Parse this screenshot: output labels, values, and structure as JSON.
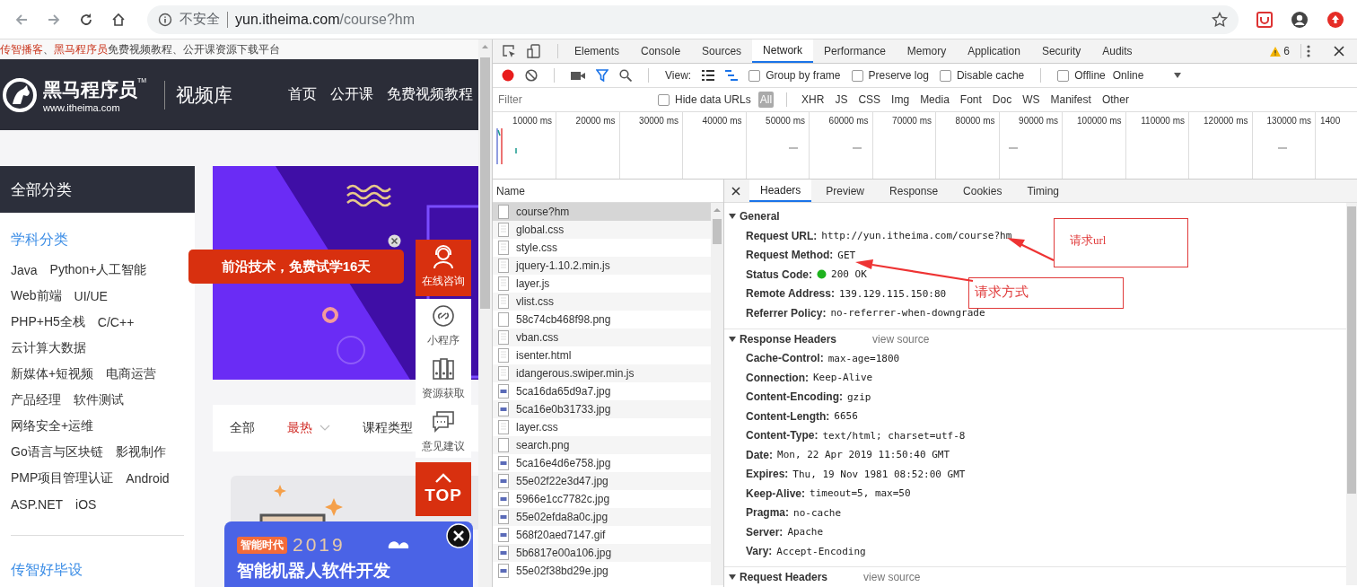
{
  "browser": {
    "security_label": "不安全",
    "url_host": "yun.itheima.com",
    "url_path": "/course?hm"
  },
  "page": {
    "notice": [
      {
        "text": "传智播客",
        "highlight": true
      },
      {
        "text": "、",
        "highlight": false
      },
      {
        "text": "黑马程序员",
        "highlight": true
      },
      {
        "text": "免费视频教程、公开课资源下载平台",
        "highlight": false
      }
    ],
    "logo": {
      "brand": "黑马程序员",
      "trademark": "TM",
      "site": "www.itheima.com",
      "section": "视频库"
    },
    "nav": [
      "首页",
      "公开课",
      "免费视频教程"
    ],
    "sidebar": {
      "title": "全部分类",
      "section": "学科分类",
      "rows": [
        [
          "Java",
          "Python+人工智能"
        ],
        [
          "Web前端",
          "UI/UE"
        ],
        [
          "PHP+H5全栈",
          "C/C++"
        ],
        [
          "云计算大数据"
        ],
        [
          "新媒体+短视频",
          "电商运营"
        ],
        [
          "产品经理",
          "软件测试"
        ],
        [
          "网络安全+运维"
        ],
        [
          "Go语言与区块链",
          "影视制作"
        ],
        [
          "PMP项目管理认证",
          "Android"
        ],
        [
          "ASP.NET",
          "iOS"
        ]
      ],
      "footer": "传智好毕设"
    },
    "promo": "前沿技术，免费试学16天",
    "side_tools": [
      {
        "kind": "accent",
        "label": "在线咨询"
      },
      {
        "kind": "plain",
        "label": "小程序"
      },
      {
        "kind": "plain",
        "label": "资源获取"
      },
      {
        "kind": "plain",
        "label": "意见建议"
      }
    ],
    "top_button": "TOP",
    "filters": [
      {
        "label": "全部",
        "selected": false,
        "dropdown": false
      },
      {
        "label": "最热",
        "selected": true,
        "dropdown": true
      },
      {
        "label": "课程类型",
        "selected": false,
        "dropdown": false
      }
    ],
    "ad": {
      "badge": "智能时代",
      "year": "2019",
      "title": "智能机器人软件开发"
    }
  },
  "devtools": {
    "tabs": [
      {
        "label": "Elements",
        "selected": false
      },
      {
        "label": "Console",
        "selected": false
      },
      {
        "label": "Sources",
        "selected": false
      },
      {
        "label": "Network",
        "selected": true
      },
      {
        "label": "Performance",
        "selected": false
      },
      {
        "label": "Memory",
        "selected": false
      },
      {
        "label": "Application",
        "selected": false
      },
      {
        "label": "Security",
        "selected": false
      },
      {
        "label": "Audits",
        "selected": false
      }
    ],
    "warnings": "6",
    "toolbar": {
      "recording": true,
      "view_label": "View:",
      "options": [
        {
          "label": "Group by frame",
          "checked": false
        },
        {
          "label": "Preserve log",
          "checked": false
        },
        {
          "label": "Disable cache",
          "checked": false
        },
        {
          "label": "Offline",
          "checked": false
        }
      ],
      "throttling": "Online"
    },
    "filter": {
      "placeholder": "Filter",
      "hide_data_urls": {
        "label": "Hide data URLs",
        "checked": false
      },
      "types": [
        {
          "label": "All",
          "selected": true
        },
        {
          "label": "XHR",
          "selected": false
        },
        {
          "label": "JS",
          "selected": false
        },
        {
          "label": "CSS",
          "selected": false
        },
        {
          "label": "Img",
          "selected": false
        },
        {
          "label": "Media",
          "selected": false
        },
        {
          "label": "Font",
          "selected": false
        },
        {
          "label": "Doc",
          "selected": false
        },
        {
          "label": "WS",
          "selected": false
        },
        {
          "label": "Manifest",
          "selected": false
        },
        {
          "label": "Other",
          "selected": false
        }
      ]
    },
    "timeline_ticks": [
      "10000 ms",
      "20000 ms",
      "30000 ms",
      "40000 ms",
      "50000 ms",
      "60000 ms",
      "70000 ms",
      "80000 ms",
      "90000 ms",
      "100000 ms",
      "110000 ms",
      "120000 ms",
      "130000 ms",
      "1400"
    ],
    "requests": {
      "column": "Name",
      "rows": [
        {
          "name": "course?hm",
          "kind": "blank",
          "selected": true
        },
        {
          "name": "global.css",
          "kind": "file",
          "selected": false
        },
        {
          "name": "style.css",
          "kind": "file",
          "selected": false
        },
        {
          "name": "jquery-1.10.2.min.js",
          "kind": "file",
          "selected": false
        },
        {
          "name": "layer.js",
          "kind": "file",
          "selected": false
        },
        {
          "name": "vlist.css",
          "kind": "file",
          "selected": false
        },
        {
          "name": "58c74cb468f98.png",
          "kind": "blank",
          "selected": false
        },
        {
          "name": "vban.css",
          "kind": "file",
          "selected": false
        },
        {
          "name": "isenter.html",
          "kind": "file",
          "selected": false
        },
        {
          "name": "idangerous.swiper.min.js",
          "kind": "file",
          "selected": false
        },
        {
          "name": "5ca16da65d9a7.jpg",
          "kind": "image",
          "selected": false
        },
        {
          "name": "5ca16e0b31733.jpg",
          "kind": "image",
          "selected": false
        },
        {
          "name": "layer.css",
          "kind": "file",
          "selected": false
        },
        {
          "name": "search.png",
          "kind": "blank",
          "selected": false
        },
        {
          "name": "5ca16e4d6e758.jpg",
          "kind": "image",
          "selected": false
        },
        {
          "name": "55e02f22e3d47.jpg",
          "kind": "image",
          "selected": false
        },
        {
          "name": "5966e1cc7782c.jpg",
          "kind": "image",
          "selected": false
        },
        {
          "name": "55e02efda8a0c.jpg",
          "kind": "image",
          "selected": false
        },
        {
          "name": "568f20aed7147.gif",
          "kind": "image",
          "selected": false
        },
        {
          "name": "5b6817e00a106.jpg",
          "kind": "image",
          "selected": false
        },
        {
          "name": "55e02f38bd29e.jpg",
          "kind": "image",
          "selected": false
        }
      ]
    },
    "details": {
      "tabs": [
        {
          "label": "Headers",
          "selected": true
        },
        {
          "label": "Preview",
          "selected": false
        },
        {
          "label": "Response",
          "selected": false
        },
        {
          "label": "Cookies",
          "selected": false
        },
        {
          "label": "Timing",
          "selected": false
        }
      ],
      "sections": [
        {
          "title": "General",
          "expanded": true,
          "rows": [
            {
              "key": "Request URL:",
              "value": "http://yun.itheima.com/course?hm",
              "kind": "plain"
            },
            {
              "key": "Request Method:",
              "value": "GET",
              "kind": "plain"
            },
            {
              "key": "Status Code:",
              "value": "200 OK",
              "kind": "status"
            },
            {
              "key": "Remote Address:",
              "value": "139.129.115.150:80",
              "kind": "plain"
            },
            {
              "key": "Referrer Policy:",
              "value": "no-referrer-when-downgrade",
              "kind": "plain"
            }
          ]
        },
        {
          "title": "Response Headers",
          "action": "view source",
          "expanded": true,
          "rows": [
            {
              "key": "Cache-Control:",
              "value": "max-age=1800",
              "kind": "plain"
            },
            {
              "key": "Connection:",
              "value": "Keep-Alive",
              "kind": "plain"
            },
            {
              "key": "Content-Encoding:",
              "value": "gzip",
              "kind": "plain"
            },
            {
              "key": "Content-Length:",
              "value": "6656",
              "kind": "plain"
            },
            {
              "key": "Content-Type:",
              "value": "text/html; charset=utf-8",
              "kind": "plain"
            },
            {
              "key": "Date:",
              "value": "Mon, 22 Apr 2019 11:50:40 GMT",
              "kind": "plain"
            },
            {
              "key": "Expires:",
              "value": "Thu, 19 Nov 1981 08:52:00 GMT",
              "kind": "plain"
            },
            {
              "key": "Keep-Alive:",
              "value": "timeout=5, max=50",
              "kind": "plain"
            },
            {
              "key": "Pragma:",
              "value": "no-cache",
              "kind": "plain"
            },
            {
              "key": "Server:",
              "value": "Apache",
              "kind": "plain"
            },
            {
              "key": "Vary:",
              "value": "Accept-Encoding",
              "kind": "plain"
            }
          ]
        },
        {
          "title": "Request Headers",
          "action": "view source",
          "expanded": true
        }
      ]
    },
    "annotations": [
      {
        "text": "请求url"
      },
      {
        "text": "请求方式"
      }
    ]
  }
}
